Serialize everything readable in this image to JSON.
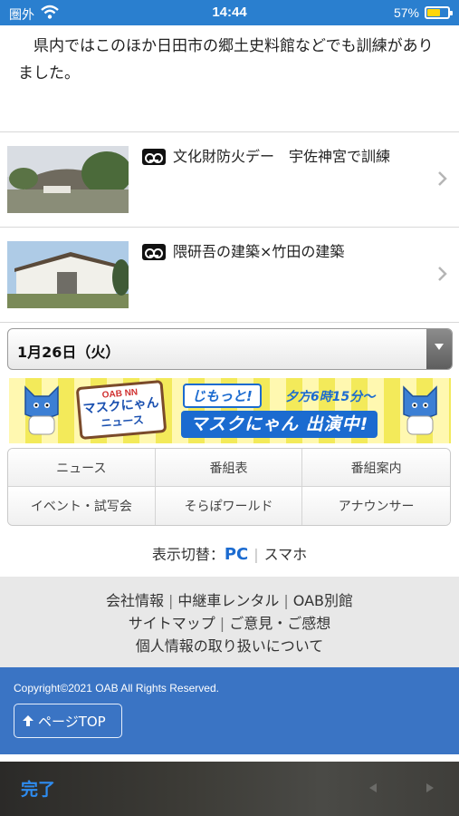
{
  "status_bar": {
    "carrier": "圏外",
    "time": "14:44",
    "battery_percent_label": "57%",
    "battery_level": 0.57,
    "accent_color": "#2a7fcf"
  },
  "article": {
    "intro_text": "県内ではこのほか日田市の郷土史料館などでも訓練がありました。"
  },
  "related_news": [
    {
      "title": "文化財防火デー　宇佐神宮で訓練",
      "icon": "video-tape-icon"
    },
    {
      "title": "隈研吾の建築×竹田の建築",
      "icon": "video-tape-icon"
    }
  ],
  "date_selector": {
    "selected": "1月26日（火）"
  },
  "banner": {
    "sign_line1": "OAB NN",
    "sign_line2": "マスクにゃん",
    "sign_line3": "ニュース",
    "jimotto": "じもっと!",
    "time_text": "夕方6時15分～",
    "appearance_text": "マスクにゃん 出演中!"
  },
  "nav": {
    "items": [
      "ニュース",
      "番組表",
      "番組案内",
      "イベント・試写会",
      "そらぽワールド",
      "アナウンサー"
    ]
  },
  "view_switch": {
    "label": "表示切替：",
    "pc": "PC",
    "smartphone": "スマホ"
  },
  "footer": {
    "row1": [
      "会社情報",
      "中継車レンタル",
      "OAB別館"
    ],
    "row2": [
      "サイトマップ",
      "ご意見・ご感想"
    ],
    "row3": [
      "個人情報の取り扱いについて"
    ],
    "copyright": "Copyright©2021 OAB All Rights Reserved.",
    "page_top_label": "ページTOP",
    "bar_color": "#3a74c4"
  },
  "keyboard_toolbar": {
    "done_label": "完了"
  }
}
